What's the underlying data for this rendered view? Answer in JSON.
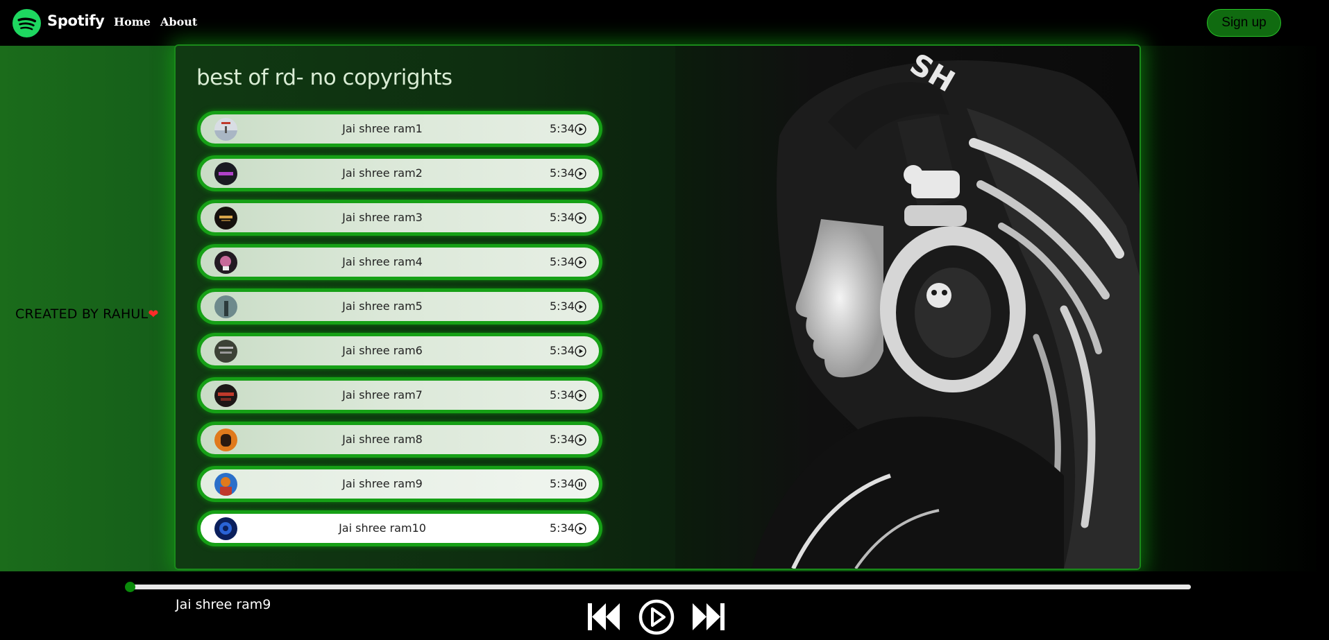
{
  "navbar": {
    "brand": "Spotify",
    "links": [
      "Home",
      "About"
    ],
    "signup_label": "Sign up",
    "logo_icon": "spotify-logo-icon"
  },
  "sidebar": {
    "credit": "CREATED BY RAHUL",
    "credit_icon": "heart-icon"
  },
  "playlist": {
    "title": "best of rd- no copyrights",
    "songs": [
      {
        "name": "Jai shree ram1",
        "duration": "5:34",
        "icon": "play-circle-icon"
      },
      {
        "name": "Jai shree ram2",
        "duration": "5:34",
        "icon": "play-circle-icon"
      },
      {
        "name": "Jai shree ram3",
        "duration": "5:34",
        "icon": "play-circle-icon"
      },
      {
        "name": "Jai shree ram4",
        "duration": "5:34",
        "icon": "play-circle-icon"
      },
      {
        "name": "Jai shree ram5",
        "duration": "5:34",
        "icon": "play-circle-icon"
      },
      {
        "name": "Jai shree ram6",
        "duration": "5:34",
        "icon": "play-circle-icon"
      },
      {
        "name": "Jai shree ram7",
        "duration": "5:34",
        "icon": "play-circle-icon"
      },
      {
        "name": "Jai shree ram8",
        "duration": "5:34",
        "icon": "play-circle-icon"
      },
      {
        "name": "Jai shree ram9",
        "duration": "5:34",
        "icon": "pause-circle-icon"
      },
      {
        "name": "Jai shree ram10",
        "duration": "5:34",
        "icon": "play-circle-icon"
      }
    ]
  },
  "player": {
    "now_playing": "Jai shree ram9",
    "progress": 0.0,
    "controls": [
      "previous-icon",
      "play-circle-icon",
      "next-icon"
    ]
  },
  "colors": {
    "accent": "#1ed760",
    "border_green": "#16a016",
    "progress_green": "#0a8a0a"
  }
}
